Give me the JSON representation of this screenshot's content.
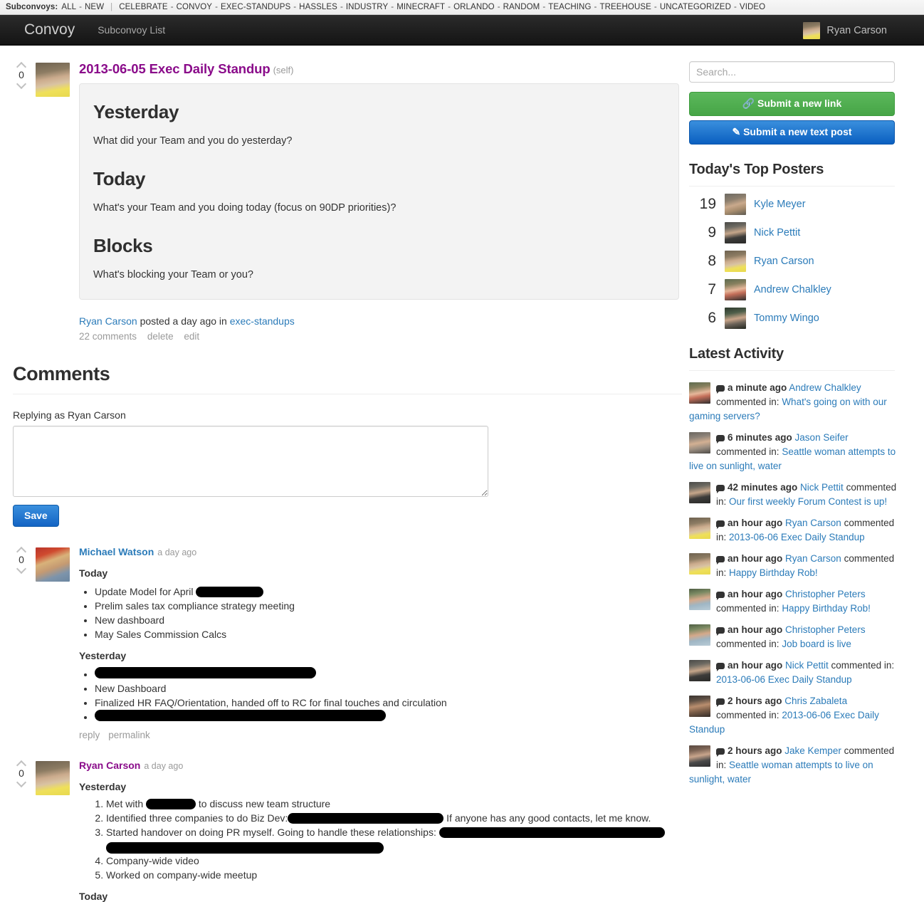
{
  "subconvoys": {
    "label": "Subconvoys:",
    "primary": [
      "ALL",
      "NEW"
    ],
    "categories": [
      "CELEBRATE",
      "CONVOY",
      "EXEC-STANDUPS",
      "HASSLES",
      "INDUSTRY",
      "MINECRAFT",
      "ORLANDO",
      "RANDOM",
      "TEACHING",
      "TREEHOUSE",
      "UNCATEGORIZED",
      "VIDEO"
    ]
  },
  "navbar": {
    "brand": "Convoy",
    "link": "Subconvoy List",
    "user_name": "Ryan Carson"
  },
  "post": {
    "score": "0",
    "title": "2013-06-05 Exec Daily Standup",
    "self_tag": "(self)",
    "sections": [
      {
        "heading": "Yesterday",
        "text": "What did your Team and you do yesterday?"
      },
      {
        "heading": "Today",
        "text": "What's your Team and you doing today (focus on 90DP priorities)?"
      },
      {
        "heading": "Blocks",
        "text": "What's blocking your Team or you?"
      }
    ],
    "meta": {
      "author": "Ryan Carson",
      "posted_text": "posted a day ago in",
      "subconvoy": "exec-standups"
    },
    "actions": {
      "comments": "22 comments",
      "delete": "delete",
      "edit": "edit"
    }
  },
  "comments_section": {
    "heading": "Comments",
    "replying_as": "Replying as Ryan Carson",
    "textarea_value": "",
    "textarea_placeholder": "",
    "save_label": "Save"
  },
  "comments": [
    {
      "score": "0",
      "author": "Michael Watson",
      "author_color": "blue",
      "time": "a day ago",
      "avatar": "av-michael",
      "blocks": [
        {
          "type": "heading",
          "text": "Today"
        },
        {
          "type": "ul",
          "items": [
            {
              "text": "Update Model for April ",
              "redact_after": 95
            },
            {
              "text": "Prelim sales tax compliance strategy meeting"
            },
            {
              "text": "New dashboard"
            },
            {
              "text": "May Sales Commission Calcs"
            }
          ]
        },
        {
          "type": "heading",
          "text": "Yesterday"
        },
        {
          "type": "ul",
          "items": [
            {
              "text": "",
              "redact_block": 311
            },
            {
              "text": "New Dashboard"
            },
            {
              "text": "Finalized HR FAQ/Orientation, handed off to RC for final touches and circulation"
            },
            {
              "text": "",
              "redact_block": 409
            }
          ]
        }
      ],
      "actions": {
        "reply": "reply",
        "permalink": "permalink"
      }
    },
    {
      "score": "0",
      "author": "Ryan Carson",
      "author_color": "purple",
      "time": "a day ago",
      "avatar": "av-ryan",
      "blocks": [
        {
          "type": "heading",
          "text": "Yesterday"
        },
        {
          "type": "ol",
          "items": [
            {
              "text": "Met with ",
              "redact_after": 70,
              "text_after": " to discuss new team structure"
            },
            {
              "text": "Identified three companies to do Biz Dev:",
              "redact_after": 219,
              "text_after": " If anyone has any good contacts, let me know."
            },
            {
              "text": "Started handover on doing PR myself. Going to handle these relationships: ",
              "redact_after": 317,
              "redact_block2": 390
            },
            {
              "text": "Company-wide video"
            },
            {
              "text": "Worked on company-wide meetup"
            }
          ]
        },
        {
          "type": "heading",
          "text": "Today"
        }
      ]
    }
  ],
  "sidebar": {
    "search_placeholder": "Search...",
    "search_value": "",
    "submit_link_label": "Submit a new link",
    "submit_text_label": "Submit a new text post",
    "top_posters_heading": "Today's Top Posters",
    "top_posters": [
      {
        "count": "19",
        "name": "Kyle Meyer",
        "avatar": "av-kyle"
      },
      {
        "count": "9",
        "name": "Nick Pettit",
        "avatar": "av-nick"
      },
      {
        "count": "8",
        "name": "Ryan Carson",
        "avatar": "av-ryan"
      },
      {
        "count": "7",
        "name": "Andrew Chalkley",
        "avatar": "av-andrew"
      },
      {
        "count": "6",
        "name": "Tommy Wingo",
        "avatar": "av-tommy"
      }
    ],
    "latest_activity_heading": "Latest Activity",
    "activity_verb": "commented in:",
    "activity": [
      {
        "time": "a minute ago",
        "user": "Andrew Chalkley",
        "target": "What's going on with our gaming servers?",
        "avatar": "av-andrew"
      },
      {
        "time": "6 minutes ago",
        "user": "Jason Seifer",
        "target": "Seattle woman attempts to live on sunlight, water",
        "avatar": "av-jason"
      },
      {
        "time": "42 minutes ago",
        "user": "Nick Pettit",
        "target": "Our first weekly Forum Contest is up!",
        "avatar": "av-nick"
      },
      {
        "time": "an hour ago",
        "user": "Ryan Carson",
        "target": "2013-06-06 Exec Daily Standup",
        "avatar": "av-ryan"
      },
      {
        "time": "an hour ago",
        "user": "Ryan Carson",
        "target": "Happy Birthday Rob!",
        "avatar": "av-ryan"
      },
      {
        "time": "an hour ago",
        "user": "Christopher Peters",
        "target": "Happy Birthday Rob!",
        "avatar": "av-chris-p"
      },
      {
        "time": "an hour ago",
        "user": "Christopher Peters",
        "target": "Job board is live",
        "avatar": "av-chris-p"
      },
      {
        "time": "an hour ago",
        "user": "Nick Pettit",
        "target": "2013-06-06 Exec Daily Standup",
        "avatar": "av-nick"
      },
      {
        "time": "2 hours ago",
        "user": "Chris Zabaleta",
        "target": "2013-06-06 Exec Daily Standup",
        "avatar": "av-chris-z"
      },
      {
        "time": "2 hours ago",
        "user": "Jake Kemper",
        "target": "Seattle woman attempts to live on sunlight, water",
        "avatar": "av-jake"
      }
    ]
  }
}
